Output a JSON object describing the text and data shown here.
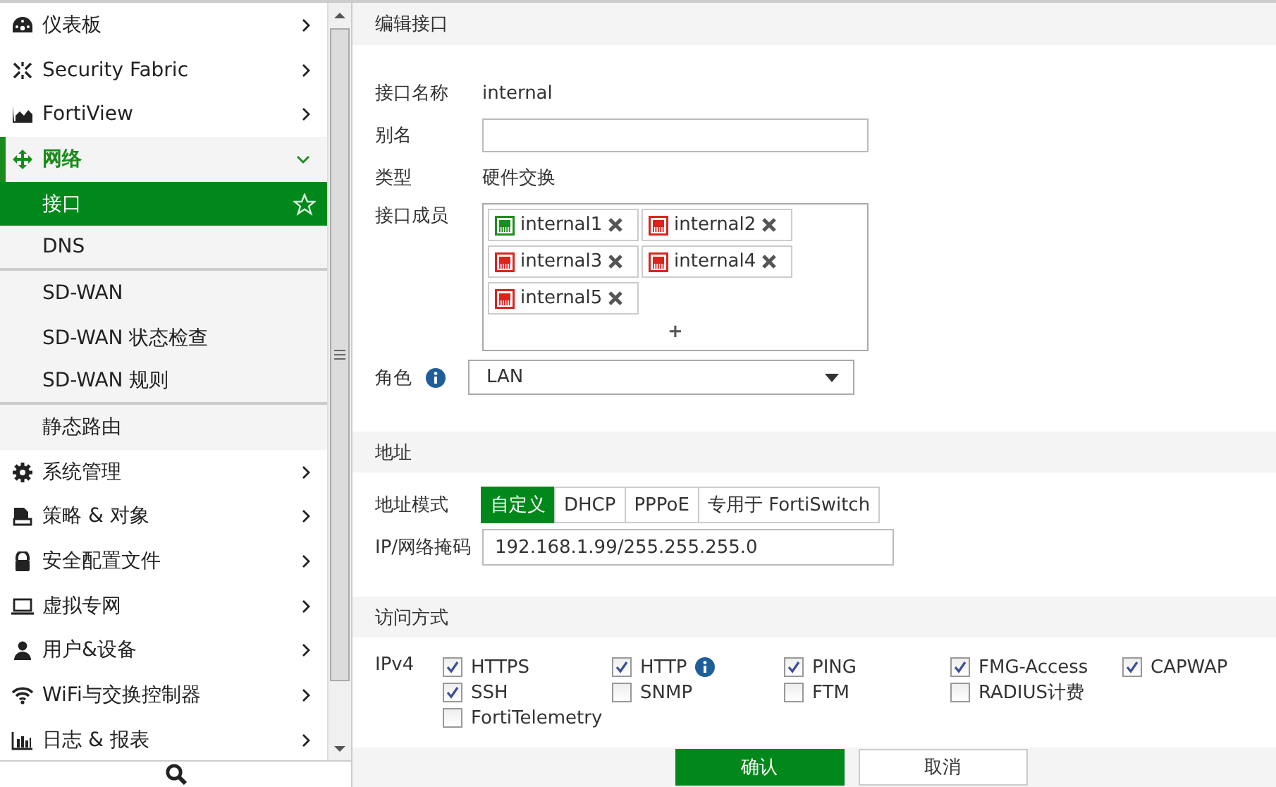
{
  "sidebar": {
    "items": [
      {
        "label": "仪表板",
        "expanded": false
      },
      {
        "label": "Security Fabric",
        "expanded": false
      },
      {
        "label": "FortiView",
        "expanded": false
      },
      {
        "label": "网络",
        "expanded": true,
        "children": [
          {
            "label": "接口",
            "selected": true,
            "favorite": true,
            "separated": false
          },
          {
            "label": "DNS",
            "selected": false,
            "favorite": false,
            "separated": true
          },
          {
            "label": "SD-WAN",
            "selected": false,
            "favorite": false,
            "separated": false
          },
          {
            "label": "SD-WAN 状态检查",
            "selected": false,
            "favorite": false,
            "separated": false
          },
          {
            "label": "SD-WAN 规则",
            "selected": false,
            "favorite": false,
            "separated": true
          },
          {
            "label": "静态路由",
            "selected": false,
            "favorite": false,
            "separated": false
          }
        ]
      },
      {
        "label": "系统管理",
        "expanded": false
      },
      {
        "label": "策略 & 对象",
        "expanded": false
      },
      {
        "label": "安全配置文件",
        "expanded": false
      },
      {
        "label": "虚拟专网",
        "expanded": false
      },
      {
        "label": "用户&设备",
        "expanded": false
      },
      {
        "label": "WiFi与交换控制器",
        "expanded": false
      },
      {
        "label": "日志 & 报表",
        "expanded": false
      }
    ]
  },
  "page": {
    "title": "编辑接口",
    "name": {
      "label": "接口名称",
      "value": "internal"
    },
    "alias": {
      "label": "别名"
    },
    "type": {
      "label": "类型",
      "value": "硬件交换"
    },
    "members": {
      "label": "接口成员",
      "add": "+",
      "items": [
        {
          "name": "internal1",
          "color": "#1e8c1e"
        },
        {
          "name": "internal2",
          "color": "#d9251c"
        },
        {
          "name": "internal3",
          "color": "#d9251c"
        },
        {
          "name": "internal4",
          "color": "#d9251c"
        },
        {
          "name": "internal5",
          "color": "#d9251c"
        }
      ]
    },
    "role": {
      "label": "角色",
      "value": "LAN"
    },
    "address": {
      "title": "地址",
      "mode": {
        "label": "地址模式",
        "options": [
          {
            "label": "自定义",
            "selected": true
          },
          {
            "label": "DHCP",
            "selected": false
          },
          {
            "label": "PPPoE",
            "selected": false
          },
          {
            "label": "专用于 FortiSwitch",
            "selected": false
          }
        ]
      },
      "ip": {
        "label": "IP/网络掩码",
        "value": "192.168.1.99/255.255.255.0"
      }
    },
    "access": {
      "title": "访问方式",
      "label": "IPv4",
      "rows": [
        [
          {
            "label": "HTTPS",
            "checked": true,
            "kind": "plain"
          },
          {
            "label": "HTTP",
            "checked": true,
            "kind": "info"
          },
          {
            "label": "PING",
            "checked": true,
            "kind": "plain"
          },
          {
            "label": "FMG-Access",
            "checked": true,
            "kind": "plain"
          },
          {
            "label": "CAPWAP",
            "checked": true,
            "kind": "plain"
          }
        ],
        [
          {
            "label": "SSH",
            "checked": true,
            "kind": "plain"
          },
          {
            "label": "SNMP",
            "checked": false,
            "kind": "plain"
          },
          {
            "label": "FTM",
            "checked": false,
            "kind": "plain"
          },
          {
            "label": "RADIUS计费",
            "checked": false,
            "kind": "plain"
          }
        ],
        [
          {
            "label": "FortiTelemetry",
            "checked": false,
            "kind": "plain"
          }
        ]
      ]
    },
    "buttons": {
      "ok": "确认",
      "cancel": "取消"
    }
  }
}
